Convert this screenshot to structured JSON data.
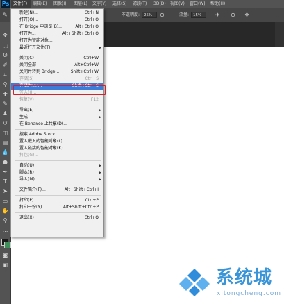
{
  "app": {
    "logo": "Ps"
  },
  "menubar": {
    "items": [
      "文件(F)",
      "编辑(E)",
      "图像(I)",
      "图层(L)",
      "文字(Y)",
      "选择(S)",
      "滤镜(T)",
      "3D(D)",
      "视图(V)",
      "窗口(W)",
      "帮助(H)"
    ]
  },
  "options": {
    "mode_label": "不透明度:",
    "opacity": "25%",
    "flow_label": "流量:",
    "flow": "15%"
  },
  "file_menu": {
    "items": [
      {
        "label": "新建(N)...",
        "shortcut": "Ctrl+N"
      },
      {
        "label": "打开(O)...",
        "shortcut": "Ctrl+O"
      },
      {
        "label": "在 Bridge 中浏览(B)...",
        "shortcut": "Alt+Ctrl+O"
      },
      {
        "label": "打开为...",
        "shortcut": "Alt+Shift+Ctrl+O"
      },
      {
        "label": "打开为智能对象...",
        "shortcut": ""
      },
      {
        "label": "最近打开文件(T)",
        "shortcut": "",
        "submenu": true
      },
      {
        "label": "关闭(C)",
        "shortcut": "Ctrl+W"
      },
      {
        "label": "关闭全部",
        "shortcut": "Alt+Ctrl+W"
      },
      {
        "label": "关闭并转到 Bridge...",
        "shortcut": "Shift+Ctrl+W"
      },
      {
        "label": "存储(S)",
        "shortcut": "Ctrl+S",
        "disabled": true
      },
      {
        "label": "存储为(A)...",
        "shortcut": "Shift+Ctrl+S",
        "highlighted": true
      },
      {
        "label": "签入(I)...",
        "shortcut": "",
        "disabled": true
      },
      {
        "label": "恢复(V)",
        "shortcut": "F12",
        "disabled": true
      },
      {
        "label": "导出(E)",
        "shortcut": "",
        "submenu": true
      },
      {
        "label": "生成",
        "shortcut": "",
        "submenu": true
      },
      {
        "label": "在 Behance 上共享(D)...",
        "shortcut": ""
      },
      {
        "label": "搜索 Adobe Stock...",
        "shortcut": ""
      },
      {
        "label": "置入嵌入的智能对象(L)...",
        "shortcut": ""
      },
      {
        "label": "置入链接的智能对象(K)...",
        "shortcut": ""
      },
      {
        "label": "打包(G)...",
        "shortcut": "",
        "disabled": true
      },
      {
        "label": "自动(U)",
        "shortcut": "",
        "submenu": true
      },
      {
        "label": "脚本(R)",
        "shortcut": "",
        "submenu": true
      },
      {
        "label": "导入(M)",
        "shortcut": "",
        "submenu": true
      },
      {
        "label": "文件简介(F)...",
        "shortcut": "Alt+Shift+Ctrl+I"
      },
      {
        "label": "打印(P)...",
        "shortcut": "Ctrl+P"
      },
      {
        "label": "打印一份(Y)",
        "shortcut": "Alt+Shift+Ctrl+P"
      },
      {
        "label": "退出(X)",
        "shortcut": "Ctrl+Q"
      }
    ]
  },
  "watermark": {
    "brand": "系统城",
    "url": "xitongcheng.com"
  },
  "colors": {
    "highlight": "#3d7bd8",
    "annotation": "#d4202c",
    "watermark": "#3a95d8"
  }
}
